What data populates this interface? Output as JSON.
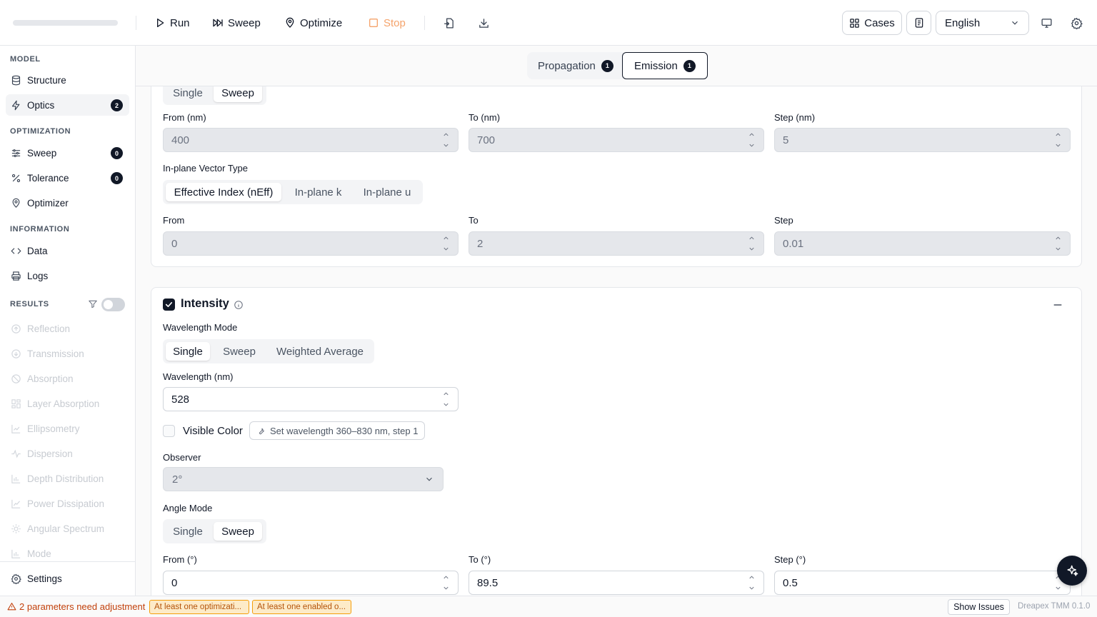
{
  "toolbar": {
    "run": "Run",
    "sweep": "Sweep",
    "optimize": "Optimize",
    "stop": "Stop",
    "cases": "Cases",
    "language": "English"
  },
  "sidebar": {
    "sections": {
      "model": "MODEL",
      "optimization": "OPTIMIZATION",
      "information": "INFORMATION",
      "results": "RESULTS"
    },
    "model_items": [
      {
        "label": "Structure",
        "icon": "database-icon"
      },
      {
        "label": "Optics",
        "icon": "bolt-icon",
        "badge": "2",
        "active": true
      }
    ],
    "optimization_items": [
      {
        "label": "Sweep",
        "icon": "sliders-icon",
        "badge": "0"
      },
      {
        "label": "Tolerance",
        "icon": "percent-icon",
        "badge": "0"
      },
      {
        "label": "Optimizer",
        "icon": "location-pin-icon"
      }
    ],
    "information_items": [
      {
        "label": "Data",
        "icon": "code-icon"
      },
      {
        "label": "Logs",
        "icon": "printer-icon"
      }
    ],
    "results_items": [
      {
        "label": "Reflection",
        "icon": "arrow-up-circle-icon"
      },
      {
        "label": "Transmission",
        "icon": "arrow-down-circle-icon"
      },
      {
        "label": "Absorption",
        "icon": "ban-icon"
      },
      {
        "label": "Layer Absorption",
        "icon": "layout-icon"
      },
      {
        "label": "Ellipsometry",
        "icon": "chart-line-icon"
      },
      {
        "label": "Dispersion",
        "icon": "pulse-icon"
      },
      {
        "label": "Depth Distribution",
        "icon": "bar-chart-icon"
      },
      {
        "label": "Power Dissipation",
        "icon": "trending-icon"
      },
      {
        "label": "Angular Spectrum",
        "icon": "sun-icon"
      },
      {
        "label": "Mode",
        "icon": "bar-chart-icon"
      }
    ],
    "settings": "Settings"
  },
  "tabs": [
    {
      "label": "Propagation",
      "badge": "1",
      "active": false
    },
    {
      "label": "Emission",
      "badge": "1",
      "active": true
    }
  ],
  "top_card": {
    "mode_options": [
      "Single",
      "Sweep"
    ],
    "mode_selected": "Sweep",
    "from_label": "From (nm)",
    "to_label": "To (nm)",
    "step_label": "Step (nm)",
    "from_value": "400",
    "to_value": "700",
    "step_value": "5",
    "vector_type_label": "In-plane Vector Type",
    "vector_options": [
      "Effective Index (nEff)",
      "In-plane k",
      "In-plane u"
    ],
    "vector_selected": "Effective Index (nEff)",
    "from2_label": "From",
    "to2_label": "To",
    "step2_label": "Step",
    "from2_value": "0",
    "to2_value": "2",
    "step2_value": "0.01"
  },
  "intensity": {
    "title": "Intensity",
    "enabled": true,
    "wavelength_mode_label": "Wavelength Mode",
    "wavelength_mode_options": [
      "Single",
      "Sweep",
      "Weighted Average"
    ],
    "wavelength_mode_selected": "Single",
    "wavelength_label": "Wavelength (nm)",
    "wavelength_value": "528",
    "visible_color_label": "Visible Color",
    "visible_color_checked": false,
    "visible_color_hint": "Set wavelength 360–830 nm, step 1",
    "observer_label": "Observer",
    "observer_value": "2°",
    "angle_mode_label": "Angle Mode",
    "angle_mode_options": [
      "Single",
      "Sweep"
    ],
    "angle_mode_selected": "Sweep",
    "from_label": "From (°)",
    "to_label": "To (°)",
    "step_label": "Step (°)",
    "from_value": "0",
    "to_value": "89.5",
    "step_value": "0.5"
  },
  "status": {
    "warning": "2 parameters need adjustment",
    "issues": [
      "At least one optimizati...",
      "At least one enabled o..."
    ],
    "show_issues": "Show Issues",
    "version": "Dreapex TMM 0.1.0"
  },
  "colors": {
    "accent": "#111827",
    "stop": "#f5a36b",
    "warning_text": "#c2410c",
    "issue_bg": "#fdebc8",
    "issue_border": "#f59e0b"
  }
}
